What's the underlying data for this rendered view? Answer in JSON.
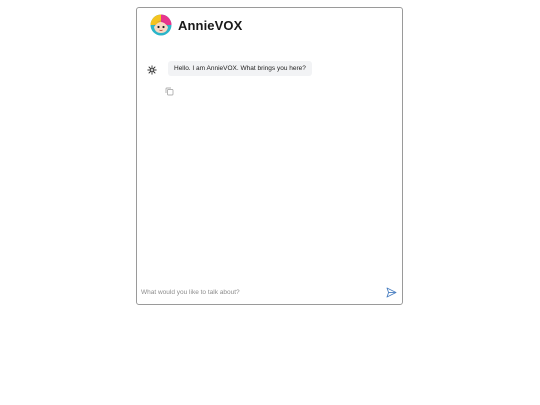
{
  "header": {
    "title": "AnnieVOX",
    "avatar_icon": "annievox-avatar-icon"
  },
  "messages": [
    {
      "sender": "bot",
      "icon": "sparkle-icon",
      "text": "Hello. I am AnnieVOX. What brings you here?",
      "action_icon": "copy-icon"
    }
  ],
  "composer": {
    "placeholder": "What would you like to talk about?",
    "value": "",
    "send_icon": "send-icon"
  },
  "colors": {
    "border": "#9a9a9a",
    "bubble_background": "#f2f3f5",
    "send_accent": "#4a7fc1",
    "avatar_pink": "#e8358c",
    "avatar_teal": "#2bb5c9",
    "avatar_yellow": "#f4c320"
  }
}
